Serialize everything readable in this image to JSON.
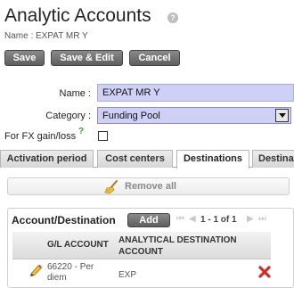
{
  "header": {
    "title": "Analytic Accounts",
    "help_glyph": "?",
    "subtitle": "Name : EXPAT MR Y"
  },
  "toolbar": {
    "save_label": "Save",
    "save_edit_label": "Save & Edit",
    "cancel_label": "Cancel"
  },
  "form": {
    "name_label": "Name :",
    "name_value": "EXPAT MR Y",
    "category_label": "Category :",
    "category_value": "Funding Pool",
    "fx_label": "For FX gain/loss",
    "fx_help": "?",
    "fx_checked": false
  },
  "tabs": [
    {
      "label": "Activation period",
      "active": false
    },
    {
      "label": "Cost centers",
      "active": false
    },
    {
      "label": "Destinations",
      "active": true
    },
    {
      "label": "Destina",
      "active": false
    }
  ],
  "remove_all": {
    "label": "Remove all",
    "icon": "broom-icon"
  },
  "grid": {
    "title": "Account/Destination",
    "add_label": "Add",
    "pager": {
      "info": "1 - 1 of 1",
      "first": "⏮",
      "prev": "◀",
      "next": "▶",
      "last": "⏭"
    },
    "columns": [
      "G/L ACCOUNT",
      "ANALYTICAL DESTINATION ACCOUNT"
    ],
    "rows": [
      {
        "gl_account": "66220 - Per diem",
        "destination": "EXP"
      }
    ]
  },
  "colors": {
    "field_background": "#cfd0f5",
    "button_background": "#6e6e6e",
    "delete_icon": "#d42a2a",
    "edit_icon": "#e8b52a"
  }
}
